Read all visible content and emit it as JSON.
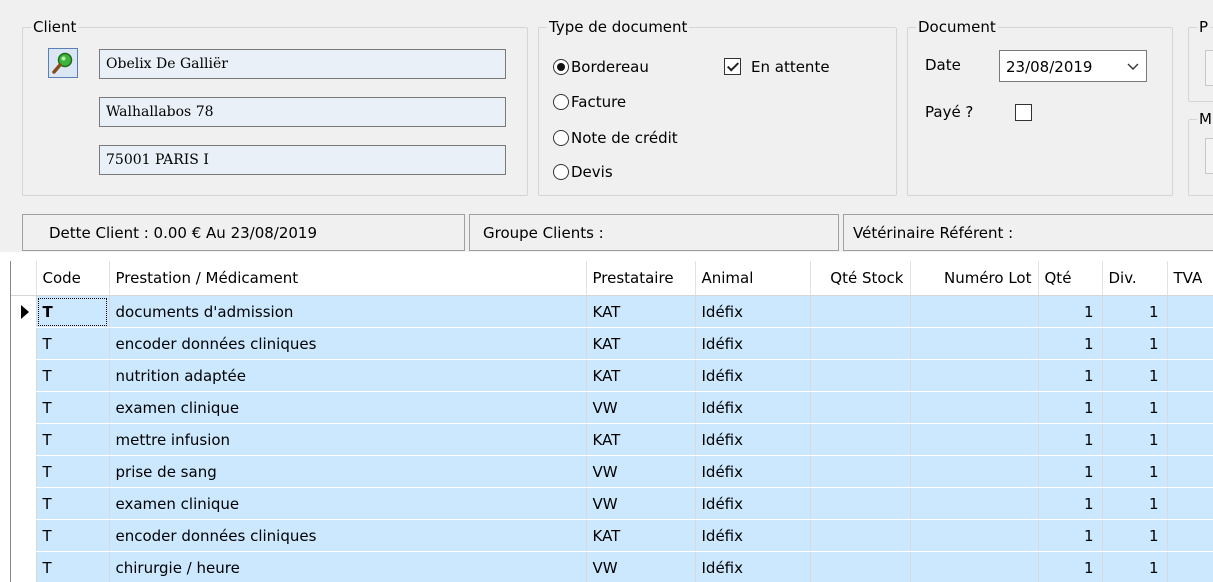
{
  "client": {
    "legend": "Client",
    "name": "Obelix De Galliër",
    "address": "Walhallabos 78",
    "city": "75001 PARIS I"
  },
  "doc_type": {
    "legend": "Type de document",
    "options": [
      "Bordereau",
      "Facture",
      "Note de crédit",
      "Devis"
    ],
    "selected": "Bordereau",
    "pending_label": "En attente",
    "pending_checked": true
  },
  "document": {
    "legend": "Document",
    "date_label": "Date",
    "date_value": "23/08/2019",
    "paid_label": "Payé ?",
    "paid_checked": false
  },
  "right_group": {
    "legend_1": "P",
    "legend_2": "M"
  },
  "status": {
    "debt": "Dette Client :  0.00 € Au 23/08/2019",
    "group": "Groupe Clients :",
    "vet": "Vétérinaire Référent :"
  },
  "table": {
    "headers": [
      "Code",
      "Prestation / Médicament",
      "Prestataire",
      "Animal",
      "Qté Stock",
      "Numéro Lot",
      "Qté",
      "Div.",
      "TVA"
    ],
    "rows": [
      {
        "code": "T",
        "item": "documents d'admission",
        "provider": "KAT",
        "animal": "Idéfix",
        "stock": "",
        "lot": "",
        "qty": "1",
        "div": "1"
      },
      {
        "code": "T",
        "item": "encoder données cliniques",
        "provider": "KAT",
        "animal": "Idéfix",
        "stock": "",
        "lot": "",
        "qty": "1",
        "div": "1"
      },
      {
        "code": "T",
        "item": "nutrition adaptée",
        "provider": "KAT",
        "animal": "Idéfix",
        "stock": "",
        "lot": "",
        "qty": "1",
        "div": "1"
      },
      {
        "code": "T",
        "item": "examen clinique",
        "provider": "VW",
        "animal": "Idéfix",
        "stock": "",
        "lot": "",
        "qty": "1",
        "div": "1"
      },
      {
        "code": "T",
        "item": "mettre infusion",
        "provider": "KAT",
        "animal": "Idéfix",
        "stock": "",
        "lot": "",
        "qty": "1",
        "div": "1"
      },
      {
        "code": "T",
        "item": "prise de sang",
        "provider": "VW",
        "animal": "Idéfix",
        "stock": "",
        "lot": "",
        "qty": "1",
        "div": "1"
      },
      {
        "code": "T",
        "item": "examen clinique",
        "provider": "VW",
        "animal": "Idéfix",
        "stock": "",
        "lot": "",
        "qty": "1",
        "div": "1"
      },
      {
        "code": "T",
        "item": "encoder données cliniques",
        "provider": "KAT",
        "animal": "Idéfix",
        "stock": "",
        "lot": "",
        "qty": "1",
        "div": "1"
      },
      {
        "code": "T",
        "item": "chirurgie / heure",
        "provider": "VW",
        "animal": "Idéfix",
        "stock": "",
        "lot": "",
        "qty": "1",
        "div": "1"
      }
    ]
  },
  "icons": {
    "client_search": "magnifier-icon",
    "row_indicator": "current-row-arrow-icon",
    "date_dropdown": "chevron-down-icon"
  },
  "colors": {
    "row_highlight": "#cce8ff",
    "input_bg": "#e9f0f8",
    "panel_bg": "#f0f0f0"
  }
}
